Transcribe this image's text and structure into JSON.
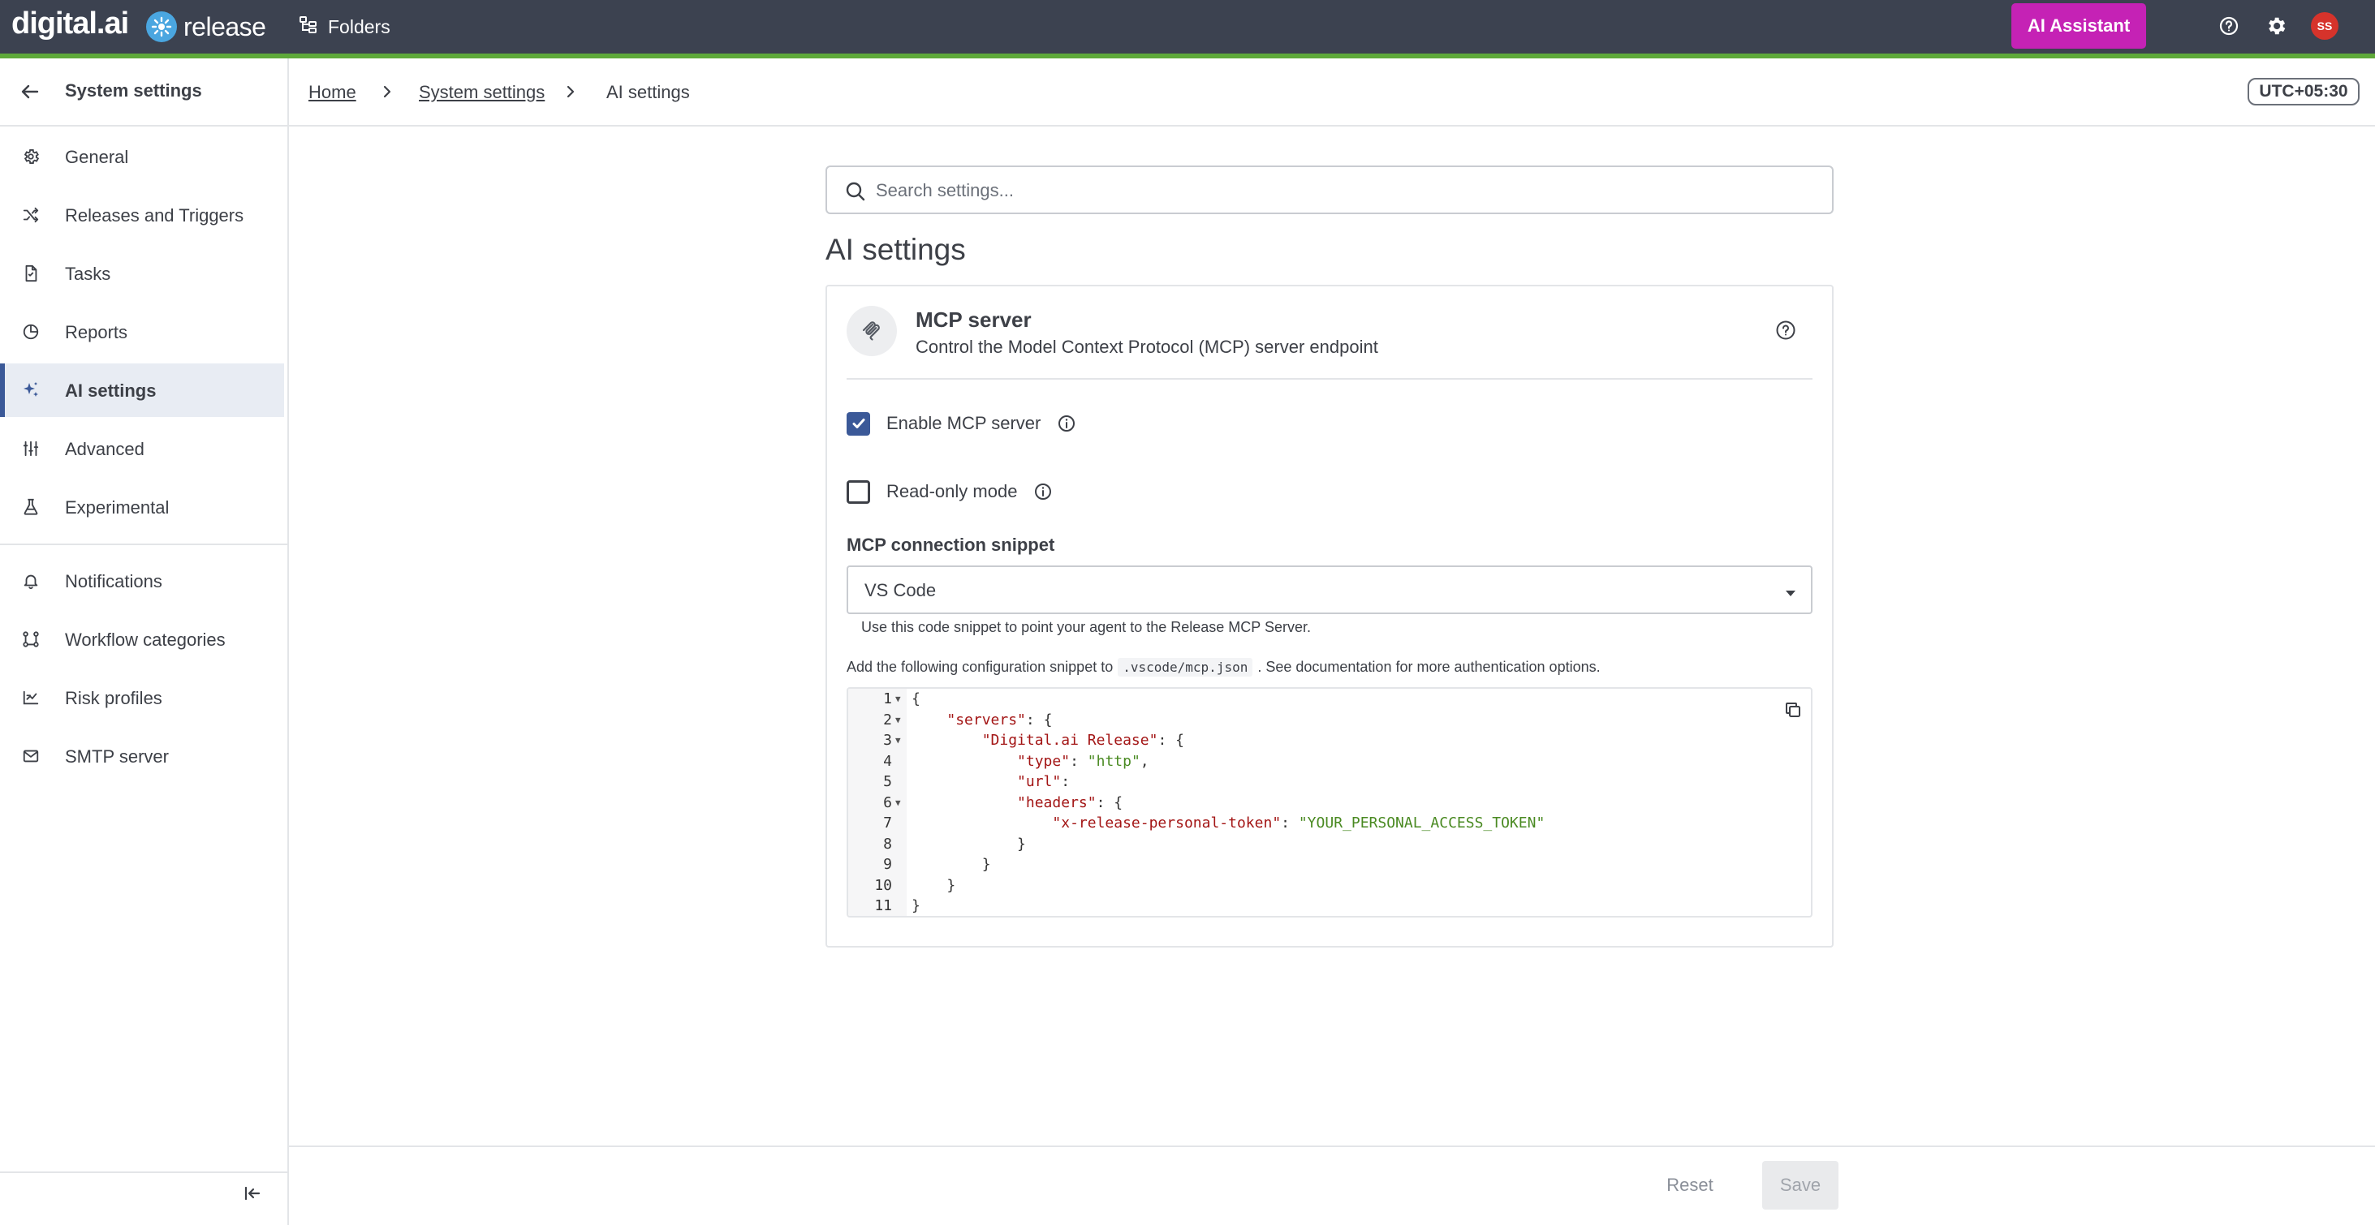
{
  "topbar": {
    "brand": "digital.ai",
    "product": "release",
    "folders_label": "Folders",
    "ai_assistant_label": "AI Assistant",
    "avatar_initials": "SS",
    "icons": [
      "help-circle-icon",
      "gear-icon"
    ]
  },
  "sidebar": {
    "title": "System settings",
    "items": [
      {
        "label": "General",
        "icon": "gear-icon",
        "active": false
      },
      {
        "label": "Releases and Triggers",
        "icon": "shuffle-icon",
        "active": false
      },
      {
        "label": "Tasks",
        "icon": "document-icon",
        "active": false
      },
      {
        "label": "Reports",
        "icon": "pie-chart-icon",
        "active": false
      },
      {
        "label": "AI settings",
        "icon": "sparkle-icon",
        "active": true
      },
      {
        "label": "Advanced",
        "icon": "sliders-icon",
        "active": false
      },
      {
        "label": "Experimental",
        "icon": "flask-icon",
        "active": false
      },
      {
        "label": "Notifications",
        "icon": "bell-icon",
        "active": false
      },
      {
        "label": "Workflow categories",
        "icon": "workflow-icon",
        "active": false
      },
      {
        "label": "Risk profiles",
        "icon": "risk-icon",
        "active": false
      },
      {
        "label": "SMTP server",
        "icon": "mail-icon",
        "active": false
      }
    ]
  },
  "breadcrumb": {
    "items": [
      "Home",
      "System settings",
      "AI settings"
    ]
  },
  "timezone": "UTC+05:30",
  "search": {
    "placeholder": "Search settings...",
    "value": ""
  },
  "page_title": "AI settings",
  "mcp": {
    "title": "MCP server",
    "subtitle": "Control the Model Context Protocol (MCP) server endpoint",
    "enable_label": "Enable MCP server",
    "enable_checked": true,
    "readonly_label": "Read-only mode",
    "readonly_checked": false,
    "snippet_label": "MCP connection snippet",
    "snippet_selected": "VS Code",
    "helper_text": "Use this code snippet to point your agent to the Release MCP Server.",
    "config_prefix": "Add the following configuration snippet to",
    "config_path": ".vscode/mcp.json",
    "config_suffix": ". See documentation for more authentication options.",
    "code_lines": [
      {
        "n": "1",
        "fold": true
      },
      {
        "n": "2",
        "fold": true
      },
      {
        "n": "3",
        "fold": true
      },
      {
        "n": "4",
        "fold": false
      },
      {
        "n": "5",
        "fold": false
      },
      {
        "n": "6",
        "fold": true
      },
      {
        "n": "7",
        "fold": false
      },
      {
        "n": "8",
        "fold": false
      },
      {
        "n": "9",
        "fold": false
      },
      {
        "n": "10",
        "fold": false
      },
      {
        "n": "11",
        "fold": false
      }
    ],
    "code": {
      "servers_key": "\"servers\"",
      "server_name_key": "\"Digital.ai Release\"",
      "type_key": "\"type\"",
      "type_value": "\"http\"",
      "url_key": "\"url\"",
      "headers_key": "\"headers\"",
      "token_key": "\"x-release-personal-token\"",
      "token_value": "\"YOUR_PERSONAL_ACCESS_TOKEN\""
    }
  },
  "footer": {
    "reset_label": "Reset",
    "save_label": "Save"
  },
  "colors": {
    "topbar": "#3c4250",
    "accent_bar": "#5ea93a",
    "ai_assistant": "#c522b5",
    "active_nav": "#e8ecf3",
    "checkbox": "#3b5998",
    "avatar": "#d6332b"
  }
}
